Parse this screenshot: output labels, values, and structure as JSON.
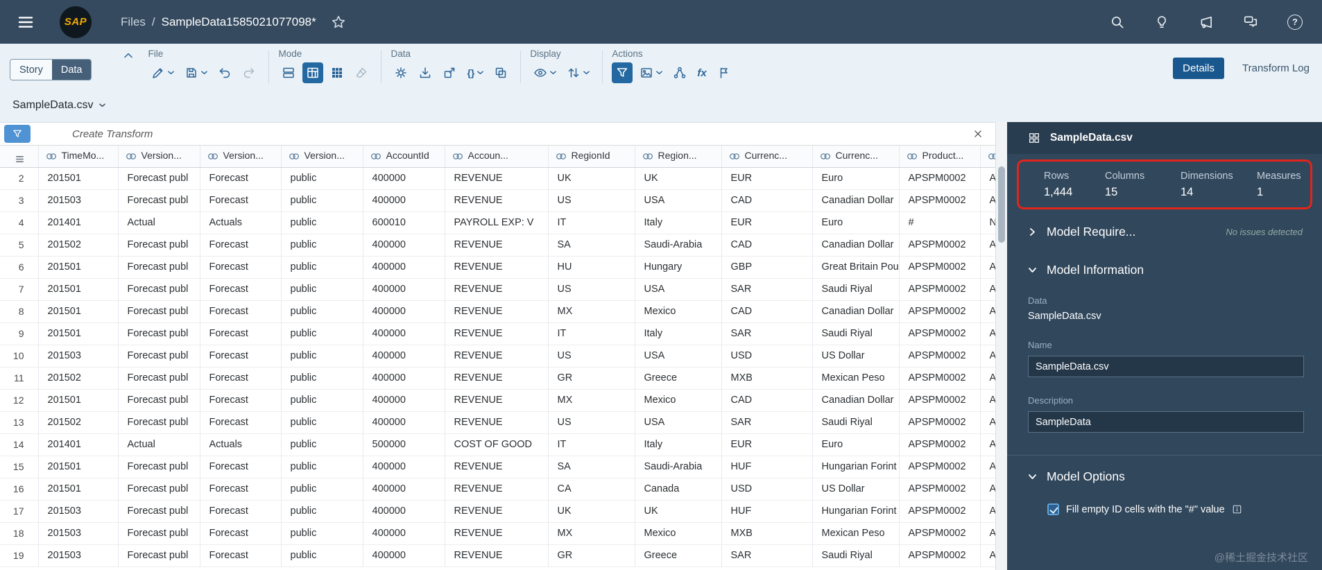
{
  "colors": {
    "shell_bg": "#354a5f",
    "toolbar_bg": "#eaf2f8",
    "panel_bg": "#31475c",
    "selected_blue": "#2368a0",
    "annotation_red": "#e1251b",
    "sap_gold": "#f0ab00"
  },
  "glyphs": {
    "sap_logo": "SAP",
    "help": "?",
    "fx": "fx",
    "braces": "{}"
  },
  "shell": {
    "breadcrumb_root": "Files",
    "breadcrumb_sep": "/",
    "title": "SampleData1585021077098*"
  },
  "toolbar": {
    "story_label": "Story",
    "data_label": "Data",
    "groups": [
      {
        "label": "File"
      },
      {
        "label": "Mode"
      },
      {
        "label": "Data"
      },
      {
        "label": "Display"
      },
      {
        "label": "Actions"
      }
    ],
    "details_label": "Details",
    "transform_log_label": "Transform Log"
  },
  "dataset": {
    "name": "SampleData.csv"
  },
  "transform_bar": {
    "label": "Create Transform"
  },
  "table": {
    "columns": [
      {
        "label": "TimeMo..."
      },
      {
        "label": "Version..."
      },
      {
        "label": "Version..."
      },
      {
        "label": "Version..."
      },
      {
        "label": "AccountId"
      },
      {
        "label": "Accoun..."
      },
      {
        "label": "RegionId"
      },
      {
        "label": "Region..."
      },
      {
        "label": "Currenc..."
      },
      {
        "label": "Currenc..."
      },
      {
        "label": "Product..."
      },
      {
        "label": ""
      }
    ],
    "rows": [
      {
        "num": "2",
        "cells": [
          "201501",
          "Forecast publ",
          "Forecast",
          "public",
          "400000",
          "REVENUE",
          "UK",
          "UK",
          "EUR",
          "Euro",
          "APSPM0002",
          "A"
        ]
      },
      {
        "num": "3",
        "cells": [
          "201503",
          "Forecast publ",
          "Forecast",
          "public",
          "400000",
          "REVENUE",
          "US",
          "USA",
          "CAD",
          "Canadian Dollar",
          "APSPM0002",
          "A"
        ]
      },
      {
        "num": "4",
        "cells": [
          "201401",
          "Actual",
          "Actuals",
          "public",
          "600010",
          "PAYROLL EXP: V",
          "IT",
          "Italy",
          "EUR",
          "Euro",
          "#",
          "N"
        ]
      },
      {
        "num": "5",
        "cells": [
          "201502",
          "Forecast publ",
          "Forecast",
          "public",
          "400000",
          "REVENUE",
          "SA",
          "Saudi-Arabia",
          "CAD",
          "Canadian Dollar",
          "APSPM0002",
          "A"
        ]
      },
      {
        "num": "6",
        "cells": [
          "201501",
          "Forecast publ",
          "Forecast",
          "public",
          "400000",
          "REVENUE",
          "HU",
          "Hungary",
          "GBP",
          "Great Britain Pou",
          "APSPM0002",
          "A"
        ]
      },
      {
        "num": "7",
        "cells": [
          "201501",
          "Forecast publ",
          "Forecast",
          "public",
          "400000",
          "REVENUE",
          "US",
          "USA",
          "SAR",
          "Saudi Riyal",
          "APSPM0002",
          "A"
        ]
      },
      {
        "num": "8",
        "cells": [
          "201501",
          "Forecast publ",
          "Forecast",
          "public",
          "400000",
          "REVENUE",
          "MX",
          "Mexico",
          "CAD",
          "Canadian Dollar",
          "APSPM0002",
          "A"
        ]
      },
      {
        "num": "9",
        "cells": [
          "201501",
          "Forecast publ",
          "Forecast",
          "public",
          "400000",
          "REVENUE",
          "IT",
          "Italy",
          "SAR",
          "Saudi Riyal",
          "APSPM0002",
          "A"
        ]
      },
      {
        "num": "10",
        "cells": [
          "201503",
          "Forecast publ",
          "Forecast",
          "public",
          "400000",
          "REVENUE",
          "US",
          "USA",
          "USD",
          "US Dollar",
          "APSPM0002",
          "A"
        ]
      },
      {
        "num": "11",
        "cells": [
          "201502",
          "Forecast publ",
          "Forecast",
          "public",
          "400000",
          "REVENUE",
          "GR",
          "Greece",
          "MXB",
          "Mexican Peso",
          "APSPM0002",
          "A"
        ]
      },
      {
        "num": "12",
        "cells": [
          "201501",
          "Forecast publ",
          "Forecast",
          "public",
          "400000",
          "REVENUE",
          "MX",
          "Mexico",
          "CAD",
          "Canadian Dollar",
          "APSPM0002",
          "A"
        ]
      },
      {
        "num": "13",
        "cells": [
          "201502",
          "Forecast publ",
          "Forecast",
          "public",
          "400000",
          "REVENUE",
          "US",
          "USA",
          "SAR",
          "Saudi Riyal",
          "APSPM0002",
          "A"
        ]
      },
      {
        "num": "14",
        "cells": [
          "201401",
          "Actual",
          "Actuals",
          "public",
          "500000",
          "COST OF GOOD",
          "IT",
          "Italy",
          "EUR",
          "Euro",
          "APSPM0002",
          "A"
        ]
      },
      {
        "num": "15",
        "cells": [
          "201501",
          "Forecast publ",
          "Forecast",
          "public",
          "400000",
          "REVENUE",
          "SA",
          "Saudi-Arabia",
          "HUF",
          "Hungarian Forint",
          "APSPM0002",
          "A"
        ]
      },
      {
        "num": "16",
        "cells": [
          "201501",
          "Forecast publ",
          "Forecast",
          "public",
          "400000",
          "REVENUE",
          "CA",
          "Canada",
          "USD",
          "US Dollar",
          "APSPM0002",
          "A"
        ]
      },
      {
        "num": "17",
        "cells": [
          "201503",
          "Forecast publ",
          "Forecast",
          "public",
          "400000",
          "REVENUE",
          "UK",
          "UK",
          "HUF",
          "Hungarian Forint",
          "APSPM0002",
          "A"
        ]
      },
      {
        "num": "18",
        "cells": [
          "201503",
          "Forecast publ",
          "Forecast",
          "public",
          "400000",
          "REVENUE",
          "MX",
          "Mexico",
          "MXB",
          "Mexican Peso",
          "APSPM0002",
          "A"
        ]
      },
      {
        "num": "19",
        "cells": [
          "201503",
          "Forecast publ",
          "Forecast",
          "public",
          "400000",
          "REVENUE",
          "GR",
          "Greece",
          "SAR",
          "Saudi Riyal",
          "APSPM0002",
          "A"
        ]
      }
    ]
  },
  "panel": {
    "title": "SampleData.csv",
    "stats": [
      {
        "label": "Rows",
        "value": "1,444"
      },
      {
        "label": "Columns",
        "value": "15"
      },
      {
        "label": "Dimensions",
        "value": "14"
      },
      {
        "label": "Measures",
        "value": "1"
      }
    ],
    "model_requirements": {
      "label": "Model Require...",
      "status": "No issues detected"
    },
    "model_information": {
      "label": "Model Information",
      "data_label": "Data",
      "data_value": "SampleData.csv",
      "name_label": "Name",
      "name_value": "SampleData.csv",
      "description_label": "Description",
      "description_value": "SampleData"
    },
    "model_options": {
      "label": "Model Options",
      "fill_empty_label": "Fill empty ID cells with the \"#\" value"
    }
  },
  "watermark": "@稀土掘金技术社区"
}
